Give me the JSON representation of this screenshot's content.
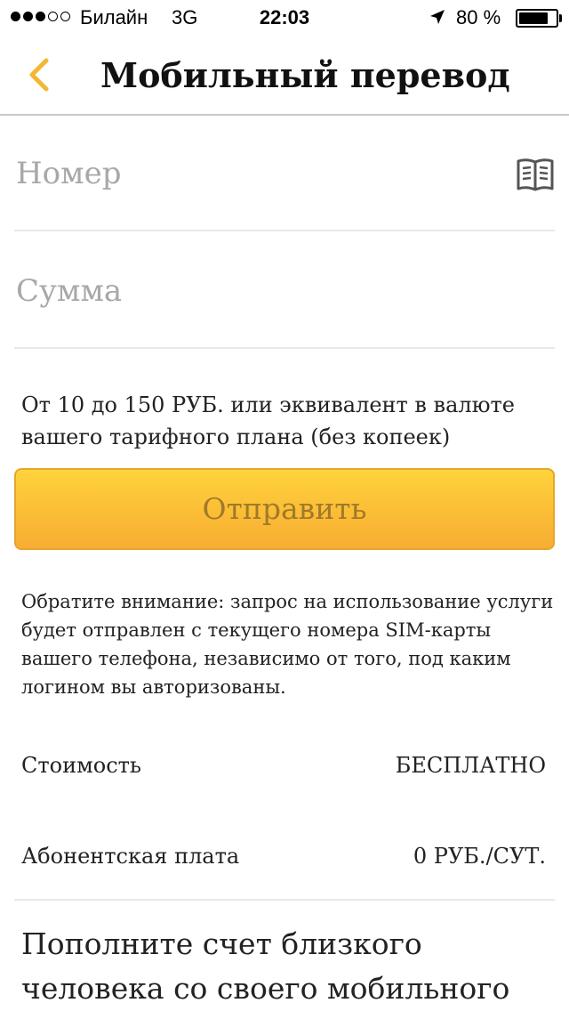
{
  "status_bar": {
    "carrier": "Билайн",
    "network": "3G",
    "time": "22:03",
    "battery_percent": "80 %",
    "battery_level": 0.8,
    "signal_bars": 3,
    "signal_total": 5
  },
  "header": {
    "title": "Мобильный перевод",
    "back_icon": "chevron-left-icon"
  },
  "form": {
    "number_placeholder": "Номер",
    "number_value": "",
    "amount_placeholder": "Сумма",
    "amount_value": "",
    "phonebook_icon": "phonebook-icon",
    "hint": "От 10 до 150 РУБ. или эквивалент в валюте вашего тарифного плана (без копеек)",
    "send_label": "Отправить"
  },
  "notice": "Обратите внимание: запрос на использование услуги будет отправлен с текущего номера SIM-карты вашего телефона, независимо от того, под каким логином вы авторизованы.",
  "info": {
    "cost_label": "Стоимость",
    "cost_value": "БЕСПЛАТНО",
    "fee_label": "Абонентская плата",
    "fee_value": "0 РУБ./СУТ."
  },
  "promo": "Пополните счет близкого человека со своего мобильного",
  "colors": {
    "accent": "#f5b731",
    "button_top": "#ffd33c",
    "button_bottom": "#f7ad33",
    "button_text": "#a07a2a"
  }
}
